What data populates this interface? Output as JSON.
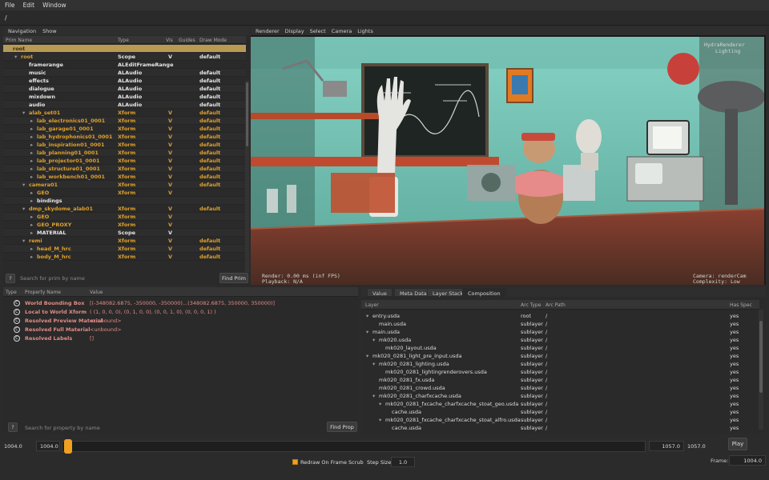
{
  "menu": {
    "file": "File",
    "edit": "Edit",
    "window": "Window"
  },
  "path": "/",
  "tree_tabs": {
    "navigation": "Navigation",
    "show": "Show"
  },
  "tree_columns": {
    "name": "Prim Name",
    "type": "Type",
    "vis": "Vis",
    "guides": "Guides",
    "draw_mode": "Draw Mode"
  },
  "tree_rows": [
    {
      "name": "root",
      "type": "",
      "vis": "",
      "draw": "",
      "indent": 0,
      "expanded": true,
      "selected": true,
      "kind": "sel"
    },
    {
      "name": "root",
      "type": "Scope",
      "vis": "V",
      "draw": "default",
      "indent": 1,
      "expanded": true,
      "kind": "xform"
    },
    {
      "name": "framerange",
      "type": "ALEditFrameRange",
      "vis": "",
      "draw": "",
      "indent": 2,
      "kind": "prim"
    },
    {
      "name": "music",
      "type": "ALAudio",
      "vis": "",
      "draw": "default",
      "indent": 2,
      "kind": "prim"
    },
    {
      "name": "effects",
      "type": "ALAudio",
      "vis": "",
      "draw": "default",
      "indent": 2,
      "kind": "prim"
    },
    {
      "name": "dialogue",
      "type": "ALAudio",
      "vis": "",
      "draw": "default",
      "indent": 2,
      "kind": "prim"
    },
    {
      "name": "mixdown",
      "type": "ALAudio",
      "vis": "",
      "draw": "default",
      "indent": 2,
      "kind": "prim"
    },
    {
      "name": "audio",
      "type": "ALAudio",
      "vis": "",
      "draw": "default",
      "indent": 2,
      "kind": "prim"
    },
    {
      "name": "alab_set01",
      "type": "Xform",
      "vis": "V",
      "draw": "default",
      "indent": 2,
      "expanded": true,
      "kind": "xform"
    },
    {
      "name": "lab_electronics01_0001",
      "type": "Xform",
      "vis": "V",
      "draw": "default",
      "indent": 3,
      "collapsed": true,
      "kind": "xform"
    },
    {
      "name": "lab_garage01_0001",
      "type": "Xform",
      "vis": "V",
      "draw": "default",
      "indent": 3,
      "collapsed": true,
      "kind": "xform"
    },
    {
      "name": "lab_hydrophonics01_0001",
      "type": "Xform",
      "vis": "V",
      "draw": "default",
      "indent": 3,
      "collapsed": true,
      "kind": "xform"
    },
    {
      "name": "lab_inspiration01_0001",
      "type": "Xform",
      "vis": "V",
      "draw": "default",
      "indent": 3,
      "collapsed": true,
      "kind": "xform"
    },
    {
      "name": "lab_planning01_0001",
      "type": "Xform",
      "vis": "V",
      "draw": "default",
      "indent": 3,
      "collapsed": true,
      "kind": "xform"
    },
    {
      "name": "lab_projector01_0001",
      "type": "Xform",
      "vis": "V",
      "draw": "default",
      "indent": 3,
      "collapsed": true,
      "kind": "xform"
    },
    {
      "name": "lab_structure01_0001",
      "type": "Xform",
      "vis": "V",
      "draw": "default",
      "indent": 3,
      "collapsed": true,
      "kind": "xform"
    },
    {
      "name": "lab_workbench01_0001",
      "type": "Xform",
      "vis": "V",
      "draw": "default",
      "indent": 3,
      "collapsed": true,
      "kind": "xform"
    },
    {
      "name": "camera01",
      "type": "Xform",
      "vis": "V",
      "draw": "default",
      "indent": 2,
      "expanded": true,
      "kind": "xform"
    },
    {
      "name": "GEO",
      "type": "Xform",
      "vis": "V",
      "draw": "",
      "indent": 3,
      "collapsed": true,
      "kind": "xform"
    },
    {
      "name": "bindings",
      "type": "",
      "vis": "",
      "draw": "",
      "indent": 3,
      "collapsed": true,
      "kind": "prim"
    },
    {
      "name": "dmp_skydome_alab01",
      "type": "Xform",
      "vis": "V",
      "draw": "default",
      "indent": 2,
      "expanded": true,
      "kind": "xform"
    },
    {
      "name": "GEO",
      "type": "Xform",
      "vis": "V",
      "draw": "",
      "indent": 3,
      "collapsed": true,
      "kind": "xform"
    },
    {
      "name": "GEO_PROXY",
      "type": "Xform",
      "vis": "V",
      "draw": "",
      "indent": 3,
      "collapsed": true,
      "kind": "xform"
    },
    {
      "name": "MATERIAL",
      "type": "Scope",
      "vis": "V",
      "draw": "",
      "indent": 3,
      "collapsed": true,
      "kind": "prim"
    },
    {
      "name": "remi",
      "type": "Xform",
      "vis": "V",
      "draw": "default",
      "indent": 2,
      "expanded": true,
      "kind": "xform"
    },
    {
      "name": "head_M_hrc",
      "type": "Xform",
      "vis": "V",
      "draw": "default",
      "indent": 3,
      "collapsed": true,
      "kind": "xform"
    },
    {
      "name": "body_M_hrc",
      "type": "Xform",
      "vis": "V",
      "draw": "default",
      "indent": 3,
      "collapsed": true,
      "kind": "xform"
    }
  ],
  "tree_search": {
    "help": "?",
    "placeholder": "Search for prim by name",
    "find": "Find Prim"
  },
  "viewport_tabs": [
    "Renderer",
    "Display",
    "Select",
    "Camera",
    "Lights"
  ],
  "hud": {
    "tr1": "HydraRenderer",
    "tr2": "Lighting",
    "bl1": "Render: 0.00 ms (inf FPS)",
    "bl2": "Playback: N/A",
    "br1": "Camera: renderCam",
    "br2": "Complexity: Low"
  },
  "prop_columns": {
    "type": "Type",
    "name": "Property Name",
    "value": "Value"
  },
  "properties": [
    {
      "name": "World Bounding Box",
      "value": "[(-348082.6875, -350000, -350000)...(348082.6875, 350000, 350000)]"
    },
    {
      "name": "Local to World Xform",
      "value": "( (1, 0, 0, 0), (0, 1, 0, 0), (0, 0, 1, 0), (0, 0, 0, 1) )"
    },
    {
      "name": "Resolved Preview Material",
      "value": "<unbound>"
    },
    {
      "name": "Resolved Full Material",
      "value": "<unbound>"
    },
    {
      "name": "Resolved Labels",
      "value": "[]"
    }
  ],
  "prop_search": {
    "help": "?",
    "placeholder": "Search for property by name",
    "find": "Find Prop"
  },
  "comp_tabs": [
    "Value",
    "Meta Data",
    "Layer Stack",
    "Composition"
  ],
  "comp_columns": {
    "layer": "Layer",
    "arc_type": "Arc Type",
    "arc_path": "Arc Path",
    "has_spec": "Has Spec"
  },
  "comp_rows": [
    {
      "layer": "entry.usda",
      "arc": "root",
      "path": "/",
      "spec": "yes",
      "indent": 0,
      "toggle": "expanded"
    },
    {
      "layer": "main.usda",
      "arc": "sublayer",
      "path": "/",
      "spec": "yes",
      "indent": 1,
      "toggle": "none"
    },
    {
      "layer": "main.usda",
      "arc": "sublayer",
      "path": "/",
      "spec": "yes",
      "indent": 0,
      "toggle": "expanded"
    },
    {
      "layer": "mk020.usda",
      "arc": "sublayer",
      "path": "/",
      "spec": "yes",
      "indent": 1,
      "toggle": "expanded"
    },
    {
      "layer": "mk020_layout.usda",
      "arc": "sublayer",
      "path": "/",
      "spec": "yes",
      "indent": 2,
      "toggle": "none"
    },
    {
      "layer": "mk020_0281_light_pre_input.usda",
      "arc": "sublayer",
      "path": "/",
      "spec": "yes",
      "indent": 0,
      "toggle": "expanded"
    },
    {
      "layer": "mk020_0281_lighting.usda",
      "arc": "sublayer",
      "path": "/",
      "spec": "yes",
      "indent": 1,
      "toggle": "expanded"
    },
    {
      "layer": "mk020_0281_lightingrenderovers.usda",
      "arc": "sublayer",
      "path": "/",
      "spec": "yes",
      "indent": 2,
      "toggle": "none"
    },
    {
      "layer": "mk020_0281_fx.usda",
      "arc": "sublayer",
      "path": "/",
      "spec": "yes",
      "indent": 1,
      "toggle": "none"
    },
    {
      "layer": "mk020_0281_crowd.usda",
      "arc": "sublayer",
      "path": "/",
      "spec": "yes",
      "indent": 1,
      "toggle": "none"
    },
    {
      "layer": "mk020_0281_charfxcache.usda",
      "arc": "sublayer",
      "path": "/",
      "spec": "yes",
      "indent": 1,
      "toggle": "expanded"
    },
    {
      "layer": "mk020_0281_fxcache_charfxcache_stoat_geo.usda",
      "arc": "sublayer",
      "path": "/",
      "spec": "yes",
      "indent": 2,
      "toggle": "expanded"
    },
    {
      "layer": "cache.usda",
      "arc": "sublayer",
      "path": "/",
      "spec": "yes",
      "indent": 3,
      "toggle": "none"
    },
    {
      "layer": "mk020_0281_fxcache_charfxcache_stoat_alfro.usda",
      "arc": "sublayer",
      "path": "/",
      "spec": "yes",
      "indent": 2,
      "toggle": "expanded"
    },
    {
      "layer": "cache.usda",
      "arc": "sublayer",
      "path": "/",
      "spec": "yes",
      "indent": 3,
      "toggle": "none"
    }
  ],
  "timeline": {
    "range_start": "1004.0",
    "current_start": "1004.0",
    "current_end": "1057.0",
    "range_end": "1057.0",
    "play": "Play",
    "redraw": "Redraw On Frame Scrub",
    "step_label": "Step Size",
    "step_value": "1.0",
    "frame_label": "Frame:",
    "frame_value": "1004.0",
    "progress": 0
  },
  "colors": {
    "accent": "#f0a020",
    "xform": "#e0a02a",
    "selected": "#b89a53",
    "prop": "#e08c85"
  }
}
